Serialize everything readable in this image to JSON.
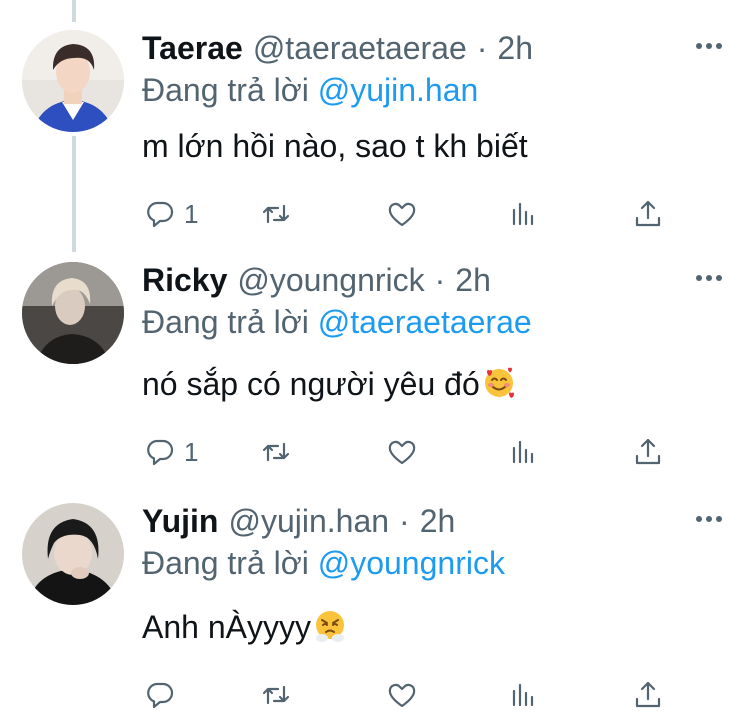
{
  "tweets": [
    {
      "name": "Taerae",
      "handle": "@taeraetaerae",
      "separator": "·",
      "time": "2h",
      "reply_prefix": "Đang trả lời",
      "reply_to": "@yujin.han",
      "text": "m lớn hồi nào, sao t kh biết",
      "emoji": "",
      "reply_count": "1"
    },
    {
      "name": "Ricky",
      "handle": "@youngnrick",
      "separator": "·",
      "time": "2h",
      "reply_prefix": "Đang trả lời",
      "reply_to": "@taeraetaerae",
      "text": "nó sắp có người yêu đó",
      "emoji": "smiling-face-with-hearts",
      "reply_count": "1"
    },
    {
      "name": "Yujin",
      "handle": "@yujin.han",
      "separator": "·",
      "time": "2h",
      "reply_prefix": "Đang trả lời",
      "reply_to": "@youngnrick",
      "text": "Anh nÀyyyy",
      "emoji": "face-with-steam-from-nose",
      "reply_count": ""
    }
  ],
  "colors": {
    "link": "#1d9bf0",
    "secondary_text": "#536471",
    "primary_text": "#0f1419",
    "thread_line": "#cfd9de"
  },
  "icons": [
    "reply-icon",
    "retweet-icon",
    "like-icon",
    "views-icon",
    "share-icon",
    "more-icon"
  ]
}
